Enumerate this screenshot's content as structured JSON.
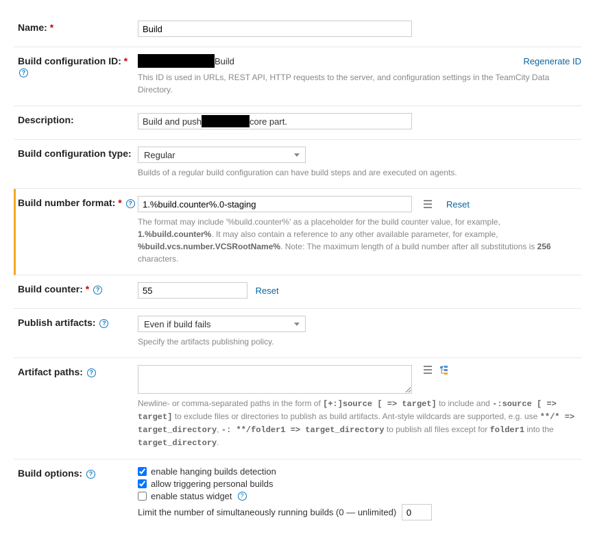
{
  "name": {
    "label": "Name:",
    "value": "Build"
  },
  "buildId": {
    "label": "Build configuration ID:",
    "suffix": "Build",
    "regenerate": "Regenerate ID",
    "hint": "This ID is used in URLs, REST API, HTTP requests to the server, and configuration settings in the TeamCity Data Directory."
  },
  "description": {
    "label": "Description:",
    "prefix": "Build and push",
    "suffix": "core part."
  },
  "configType": {
    "label": "Build configuration type:",
    "value": "Regular",
    "hint": "Builds of a regular build configuration can have build steps and are executed on agents."
  },
  "buildNumberFormat": {
    "label": "Build number format:",
    "value": "1.%build.counter%.0-staging",
    "reset": "Reset",
    "hint_p1": "The format may include '%build.counter%' as a placeholder for the build counter value, for example, ",
    "hint_b1": "1.%build.counter%",
    "hint_p2": ". It may also contain a reference to any other available parameter, for example, ",
    "hint_b2": "%build.vcs.number.VCSRootName%",
    "hint_p3": ". Note: The maximum length of a build number after all substitutions is ",
    "hint_b3": "256",
    "hint_p4": " characters."
  },
  "buildCounter": {
    "label": "Build counter:",
    "value": "55",
    "reset": "Reset"
  },
  "publishArtifacts": {
    "label": "Publish artifacts:",
    "value": "Even if build fails",
    "hint": "Specify the artifacts publishing policy."
  },
  "artifactPaths": {
    "label": "Artifact paths:",
    "value": "",
    "hint_p1": "Newline- or comma-separated paths in the form of ",
    "hint_m1": "[+:]source [ => target]",
    "hint_p2": " to include and ",
    "hint_m2": "-:source [ => target]",
    "hint_p3": " to exclude files or directories to publish as build artifacts. Ant-style wildcards are supported, e.g. use ",
    "hint_m3": "**/* => target_directory",
    "hint_c1": ", ",
    "hint_m4": "-: **/folder1 => target_directory",
    "hint_p4": " to publish all files except for ",
    "hint_m5": "folder1",
    "hint_p5": " into the ",
    "hint_m6": "target_directory",
    "hint_p6": "."
  },
  "buildOptions": {
    "label": "Build options:",
    "opt1": "enable hanging builds detection",
    "opt2": "allow triggering personal builds",
    "opt3": "enable status widget",
    "limitLabel": "Limit the number of simultaneously running builds (0 — unlimited)",
    "limitValue": "0"
  }
}
